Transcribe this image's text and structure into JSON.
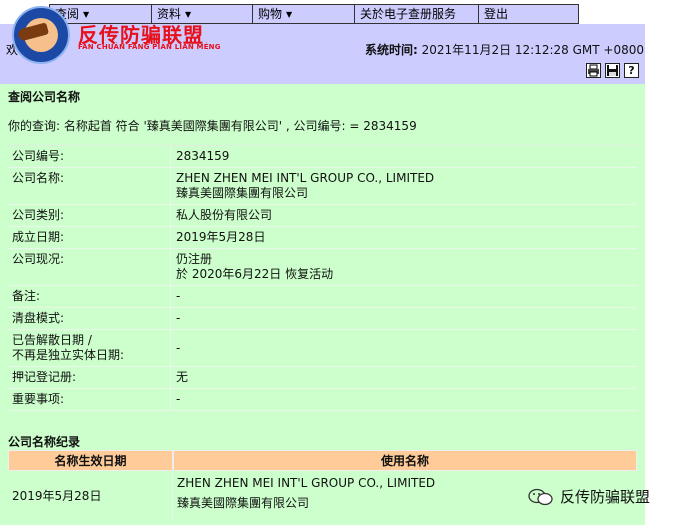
{
  "menu": {
    "items": [
      {
        "label": "查阅",
        "dropdown": true
      },
      {
        "label": "资料",
        "dropdown": true
      },
      {
        "label": "购物",
        "dropdown": true
      },
      {
        "label": "关於电子查册服务",
        "dropdown": false
      },
      {
        "label": "登出",
        "dropdown": false
      }
    ]
  },
  "header": {
    "welcome_fragment": "欢",
    "logo_title": "反传防骗联盟",
    "logo_sub": "FĂN CHUÁN FÁNG PIÀN LIÁN MÉNG",
    "systime_label": "系统时间:",
    "systime_value": "2021年11月2日 12:12:28 GMT +0800"
  },
  "toolbar": {
    "print_icon": "printer-icon",
    "save_icon": "floppy-icon",
    "help_icon": "help-icon"
  },
  "search": {
    "section_title": "查阅公司名称",
    "query_text": "你的查询:  名称起首 符合 '臻真美國際集團有限公司' , 公司编号:   = 2834159"
  },
  "company": {
    "rows": [
      {
        "label": "公司编号:",
        "value": "2834159",
        "value2": ""
      },
      {
        "label": "公司名称:",
        "value": "ZHEN ZHEN MEI INT'L GROUP CO., LIMITED",
        "value2": "臻真美國際集團有限公司"
      },
      {
        "label": "公司类别:",
        "value": "私人股份有限公司",
        "value2": ""
      },
      {
        "label": "成立日期:",
        "value": "2019年5月28日",
        "value2": ""
      },
      {
        "label": "公司现况:",
        "value": "仍注册",
        "value2": "於 2020年6月22日 恢复活动"
      },
      {
        "label": "备注:",
        "value": "-",
        "value2": ""
      },
      {
        "label": "清盘模式:",
        "value": "-",
        "value2": ""
      },
      {
        "label": "已告解散日期 /",
        "label2": "不再是独立实体日期:",
        "value": "-",
        "value2": ""
      },
      {
        "label": "押记登记册:",
        "value": "无",
        "value2": ""
      },
      {
        "label": "重要事项:",
        "value": "-",
        "value2": ""
      }
    ]
  },
  "history": {
    "title": "公司名称纪录",
    "col_date": "名称生效日期",
    "col_name": "使用名称",
    "row_date": "2019年5月28日",
    "row_name_en": "ZHEN ZHEN MEI INT'L GROUP CO., LIMITED",
    "row_name_zh": "臻真美國際集團有限公司"
  },
  "watermark": {
    "text": "反传防骗联盟",
    "icon": "wechat-icon"
  }
}
